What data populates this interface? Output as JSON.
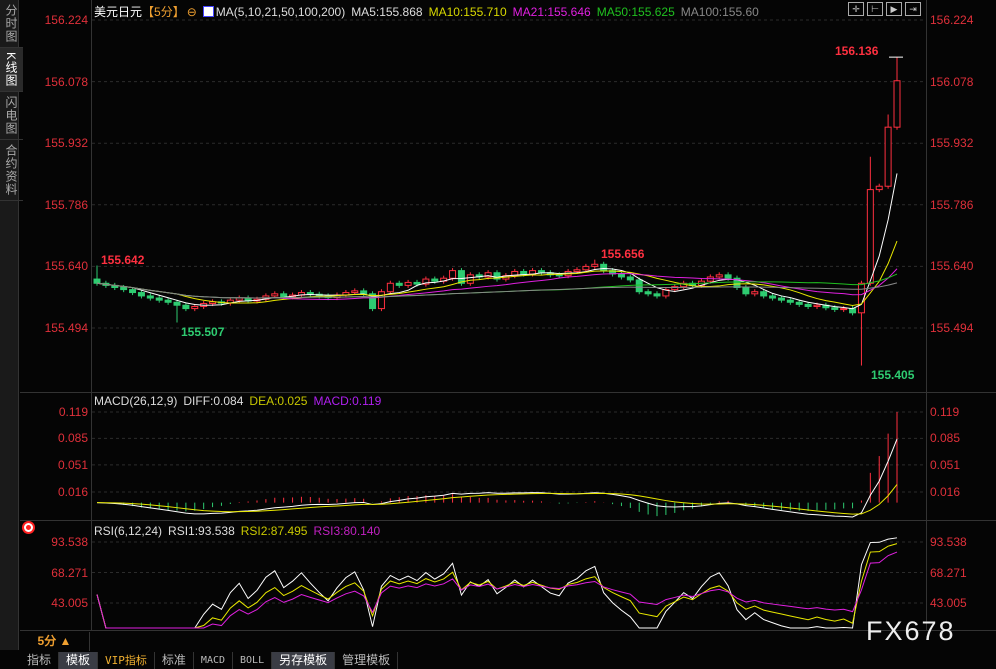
{
  "sidebar": {
    "items": [
      "分时图",
      "K线图",
      "闪电图",
      "合约资料"
    ],
    "active": 1
  },
  "header": {
    "symbol": "美元日元",
    "period": "【5分】",
    "ma_params": "MA(5,10,21,50,100,200)",
    "ma5": "MA5:155.868",
    "ma10": "MA10:155.710",
    "ma21": "MA21:155.646",
    "ma50": "MA50:155.625",
    "ma100": "MA100:155.60"
  },
  "toolbar": [
    "crosshair-icon",
    "zoom-fit-icon",
    "play-icon",
    "scroll-end-icon"
  ],
  "price_axis": [
    "156.224",
    "156.078",
    "155.932",
    "155.786",
    "155.640",
    "155.494"
  ],
  "annotations": {
    "high": "156.136",
    "left_high": "155.642",
    "left_low": "155.507",
    "mid_high": "155.656",
    "low": "155.405"
  },
  "macd": {
    "title": "MACD(26,12,9)",
    "diff": "DIFF:0.084",
    "dea": "DEA:0.025",
    "macd": "MACD:0.119",
    "axis": [
      "0.119",
      "0.085",
      "0.051",
      "0.016"
    ]
  },
  "rsi": {
    "title": "RSI(6,12,24)",
    "rsi1": "RSI1:93.538",
    "rsi2": "RSI2:87.495",
    "rsi3": "RSI3:80.140",
    "axis": [
      "93.538",
      "68.271",
      "43.005"
    ]
  },
  "period_selector": "5分 ▲",
  "bottom_tabs": [
    "指标",
    "模板",
    "VIP指标",
    "标准",
    "MACD",
    "BOLL",
    "另存模板",
    "管理模板"
  ],
  "watermark": "FX678",
  "colors": {
    "up": "#ff3040",
    "down": "#2ecc71",
    "ma5": "#ffffff",
    "ma10": "#e8e800",
    "ma21": "#e020e0",
    "ma50": "#20c020",
    "ma100": "#888888"
  },
  "chart_data": {
    "type": "candlestick",
    "price_range": [
      155.36,
      156.26
    ],
    "closes": [
      155.6,
      155.595,
      155.59,
      155.585,
      155.578,
      155.57,
      155.565,
      155.56,
      155.555,
      155.548,
      155.54,
      155.545,
      155.552,
      155.556,
      155.553,
      155.56,
      155.565,
      155.558,
      155.562,
      155.57,
      155.575,
      155.568,
      155.572,
      155.578,
      155.574,
      155.57,
      155.566,
      155.572,
      155.578,
      155.582,
      155.575,
      155.54,
      155.58,
      155.6,
      155.595,
      155.602,
      155.598,
      155.61,
      155.605,
      155.612,
      155.63,
      155.6,
      155.62,
      155.615,
      155.625,
      155.61,
      155.618,
      155.628,
      155.622,
      155.63,
      155.625,
      155.62,
      155.618,
      155.628,
      155.632,
      155.64,
      155.645,
      155.63,
      155.622,
      155.615,
      155.608,
      155.58,
      155.575,
      155.57,
      155.585,
      155.592,
      155.6,
      155.595,
      155.605,
      155.615,
      155.62,
      155.612,
      155.59,
      155.575,
      155.58,
      155.57,
      155.565,
      155.56,
      155.555,
      155.55,
      155.545,
      155.548,
      155.542,
      155.538,
      155.54,
      155.53,
      155.6,
      155.822,
      155.83,
      155.97,
      156.08
    ]
  }
}
